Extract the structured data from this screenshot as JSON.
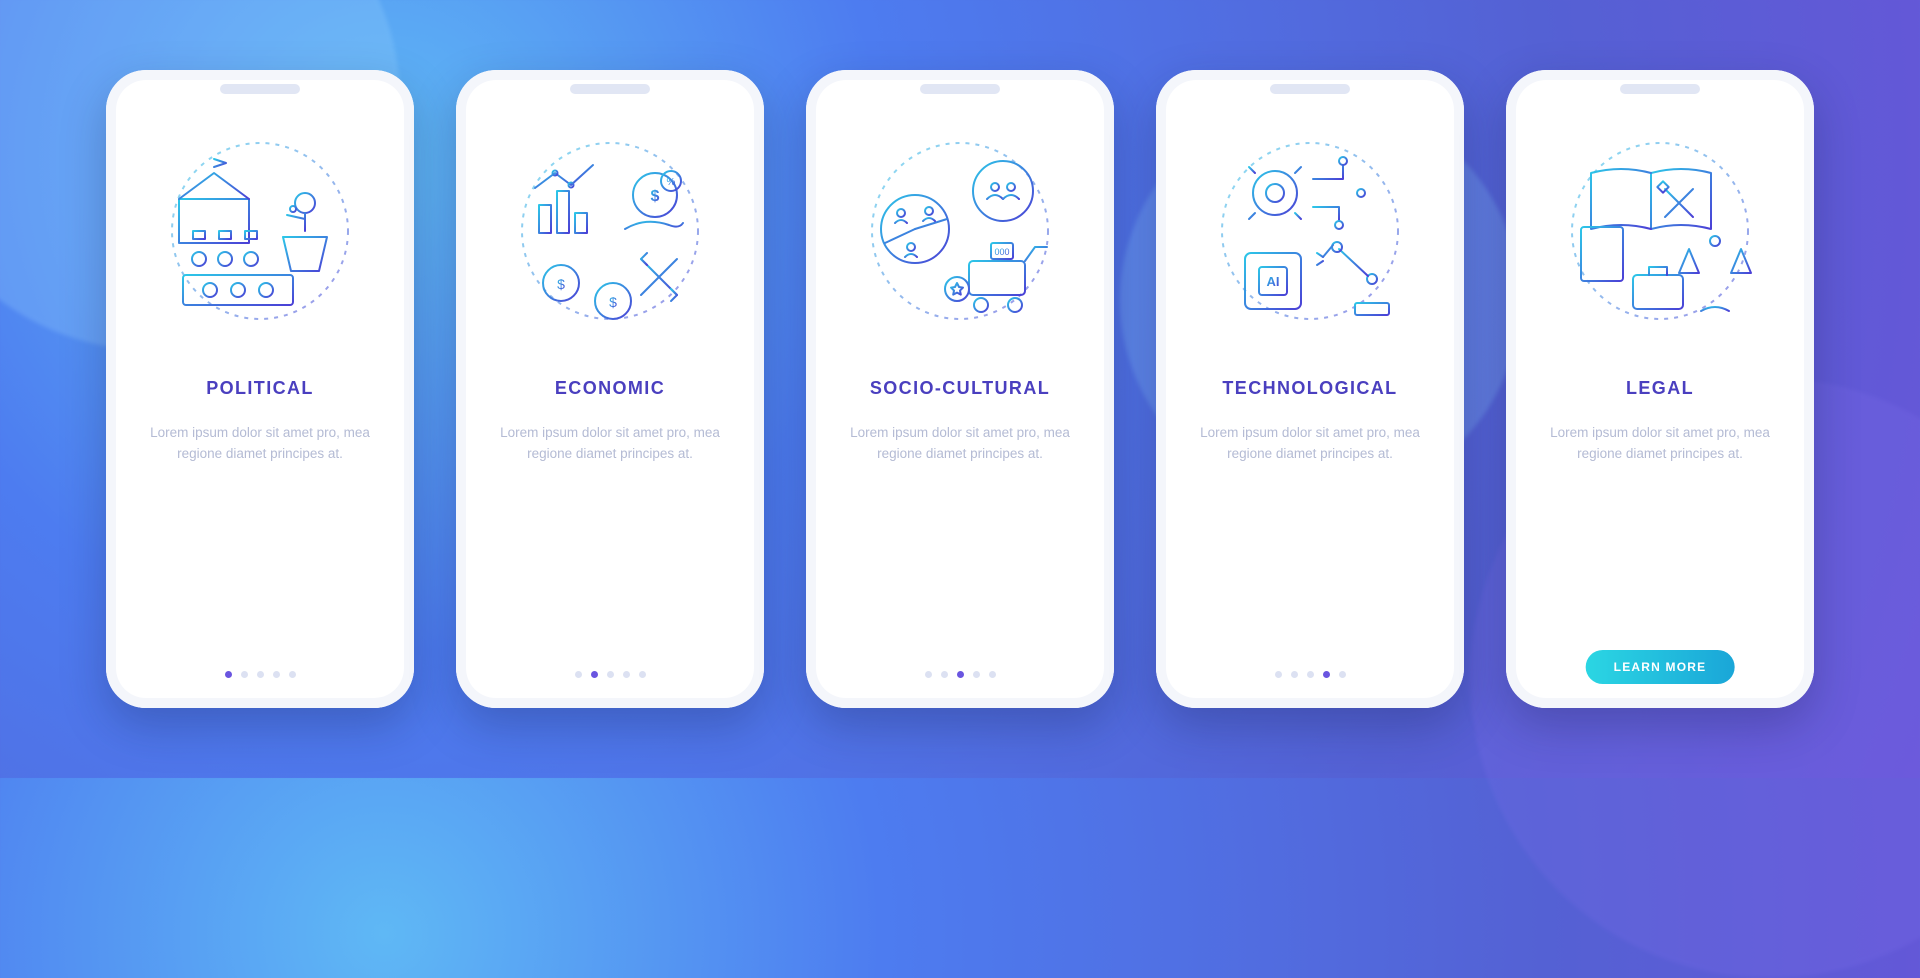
{
  "screens": [
    {
      "icon": "political-icon",
      "title": "POLITICAL",
      "desc": "Lorem ipsum dolor sit amet pro, mea regione diamet principes at.",
      "activeDot": 0
    },
    {
      "icon": "economic-icon",
      "title": "ECONOMIC",
      "desc": "Lorem ipsum dolor sit amet pro, mea regione diamet principes at.",
      "activeDot": 1
    },
    {
      "icon": "sociocultural-icon",
      "title": "SOCIO-CULTURAL",
      "desc": "Lorem ipsum dolor sit amet pro, mea regione diamet principes at.",
      "activeDot": 2
    },
    {
      "icon": "technological-icon",
      "title": "TECHNOLOGICAL",
      "desc": "Lorem ipsum dolor sit amet pro, mea regione diamet principes at.",
      "activeDot": 3
    },
    {
      "icon": "legal-icon",
      "title": "LEGAL",
      "desc": "Lorem ipsum dolor sit amet pro, mea regione diamet principes at.",
      "activeDot": 4
    }
  ],
  "dotCount": 5,
  "cta": {
    "label": "LEARN MORE"
  },
  "colors": {
    "title": "#4a3fbf",
    "ctaGradFrom": "#2bd6e3",
    "ctaGradTo": "#1aa6d8"
  }
}
